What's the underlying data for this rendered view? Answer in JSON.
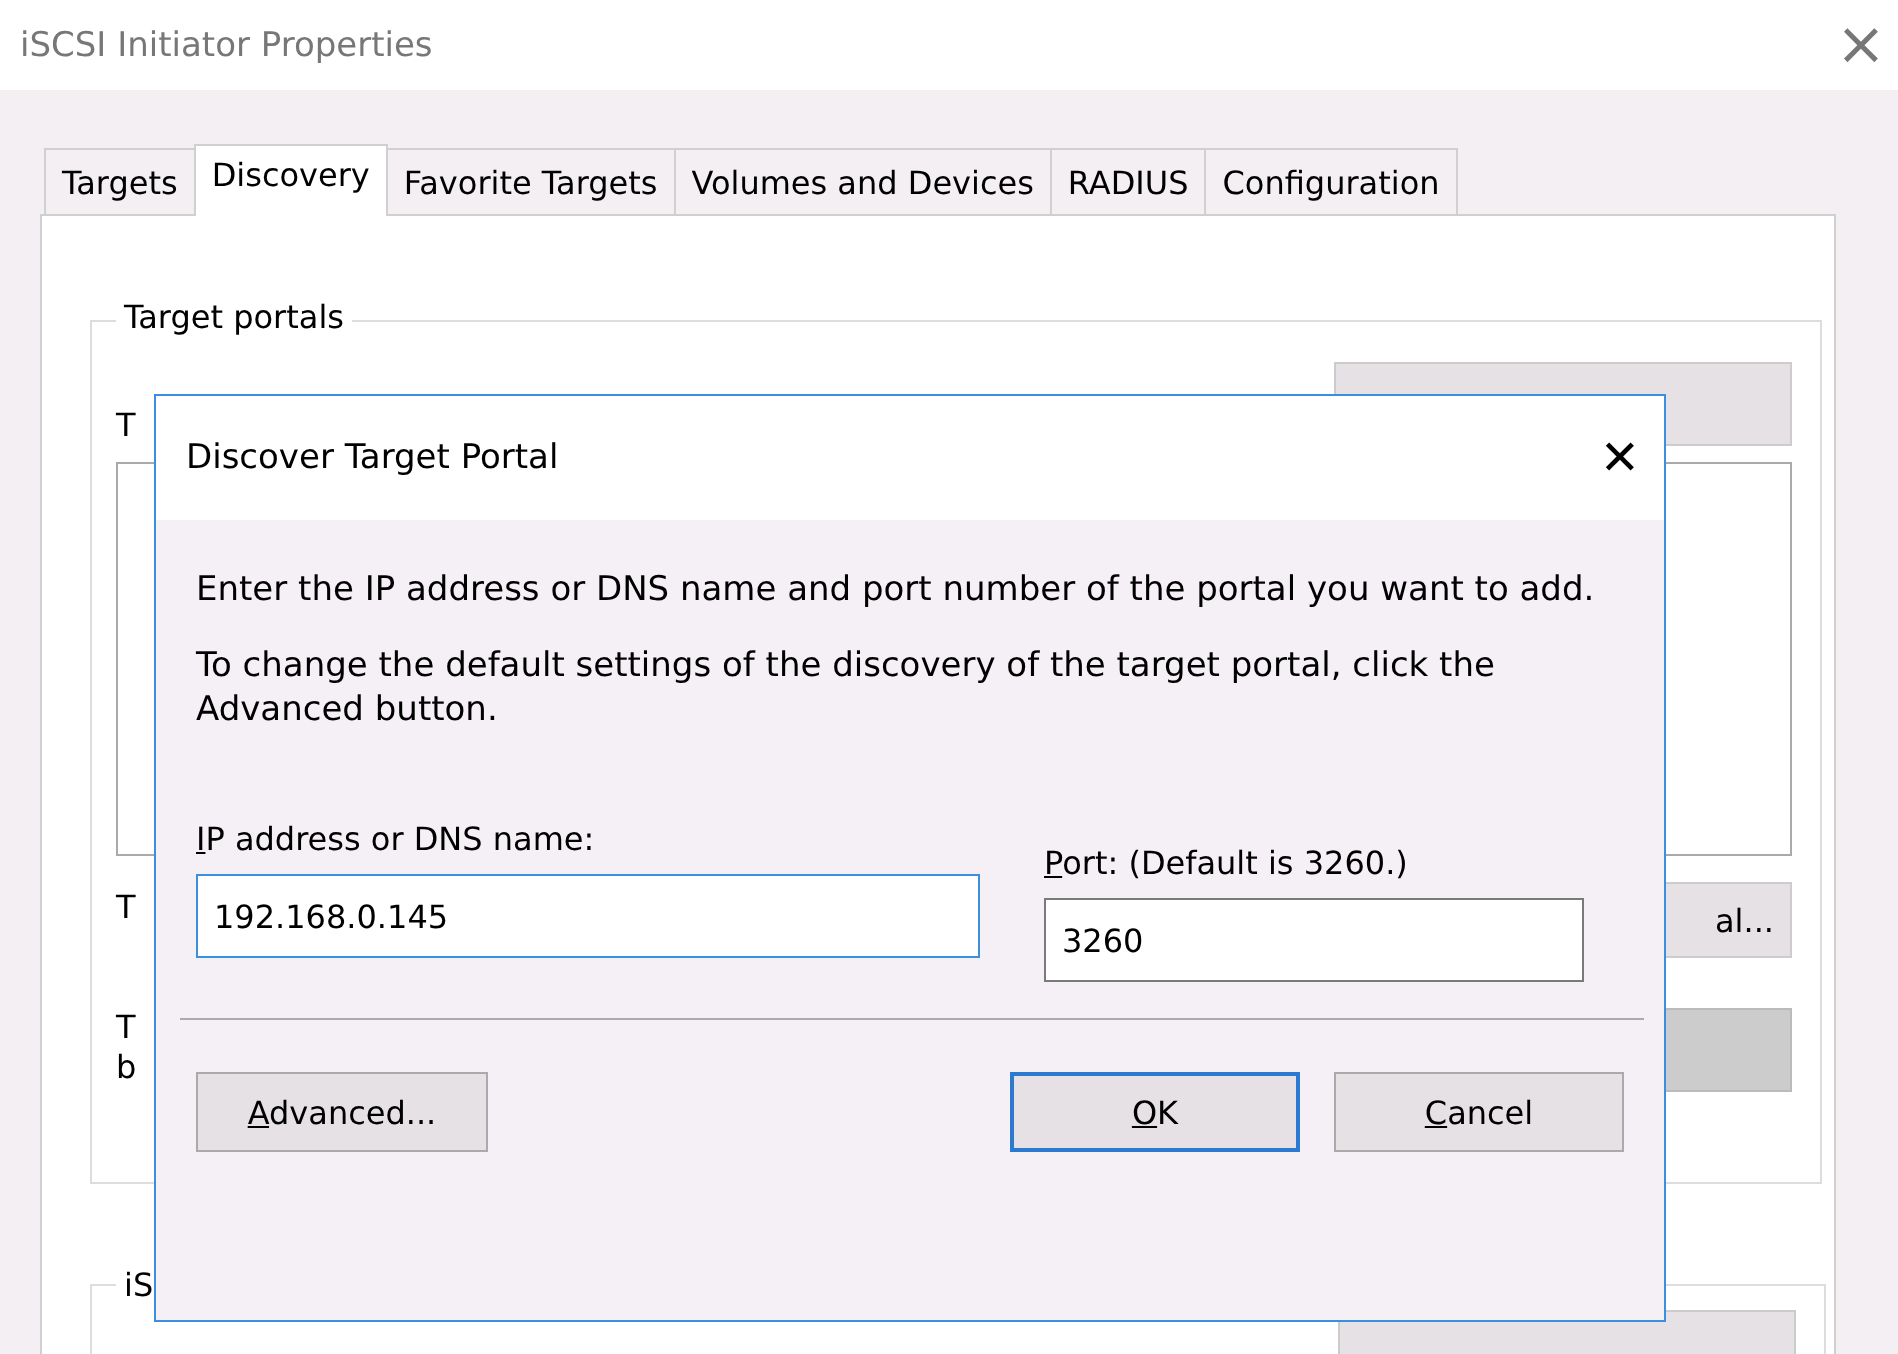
{
  "window": {
    "title": "iSCSI Initiator Properties",
    "close": "×"
  },
  "tabs": [
    {
      "label": "Targets",
      "selected": false
    },
    {
      "label": "Discovery",
      "selected": true
    },
    {
      "label": "Favorite Targets",
      "selected": false
    },
    {
      "label": "Volumes and Devices",
      "selected": false
    },
    {
      "label": "RADIUS",
      "selected": false
    },
    {
      "label": "Configuration",
      "selected": false
    }
  ],
  "target_portals": {
    "title": "Target portals",
    "text_fragments": [
      "T",
      "T",
      "T",
      "b"
    ],
    "button_fragment": "al...",
    "disabled_button": true
  },
  "second_group": {
    "title_fragment": "iS"
  },
  "dialog": {
    "title": "Discover Target Portal",
    "close": "✕",
    "intro": "Enter the IP address or DNS name and port number of the portal you want to add.",
    "advanced_note": "To change the default settings of the discovery of the target portal, click the Advanced button.",
    "address": {
      "label": "**I**P address or DNS name:",
      "value": "192.168.0.145",
      "focused": true
    },
    "port": {
      "label": "**P**ort: (Default is 3260.)",
      "value": "3260",
      "focused": false
    },
    "buttons": [
      {
        "label": "**A**dvanced...",
        "kind": "left",
        "default": false
      },
      {
        "label": "**O**K",
        "kind": "right",
        "default": true
      },
      {
        "label": "**C**ancel",
        "kind": "right",
        "default": false
      }
    ]
  }
}
